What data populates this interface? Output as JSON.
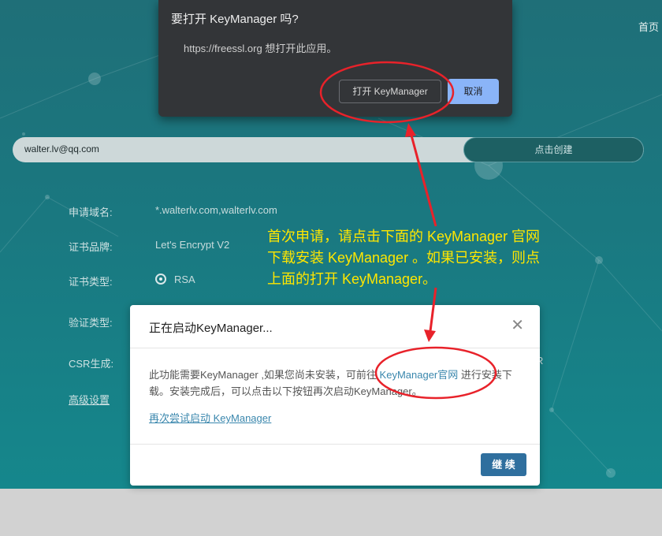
{
  "page": {
    "nav_home": "首页",
    "email": "walter.lv@qq.com",
    "create_button": "点击创建",
    "form": [
      {
        "label": "申请域名:",
        "value": "*.walterlv.com,walterlv.com"
      },
      {
        "label": "证书品牌:",
        "value": "Let's Encrypt V2"
      },
      {
        "label": "证书类型:",
        "value": "RSA"
      },
      {
        "label": "验证类型:",
        "value": ""
      },
      {
        "label": "CSR生成:",
        "value": ""
      }
    ],
    "advanced": "高级设置",
    "stray_text": "R"
  },
  "prompt": {
    "title": "要打开 KeyManager 吗?",
    "message": "https://freessl.org 想打开此应用。",
    "open_button": "打开 KeyManager",
    "cancel_button": "取消"
  },
  "annotation": {
    "lines": [
      "首次申请，请点击下面的 KeyManager 官网",
      "下载安装 KeyManager 。如果已安装，则点",
      "上面的打开 KeyManager。"
    ],
    "color": "#ffe600",
    "mark_color": "#e8222a"
  },
  "modal": {
    "title": "正在启动KeyManager...",
    "body_before": "此功能需要KeyManager ,如果您尚未安装，可前往 ",
    "body_link": "KeyManager官网",
    "body_after": " 进行安装下载。安装完成后，可以点击以下按钮再次启动KeyManager。",
    "retry_link": "再次尝试启动 KeyManager",
    "continue_button": "继 续",
    "close_icon": "close-icon"
  }
}
